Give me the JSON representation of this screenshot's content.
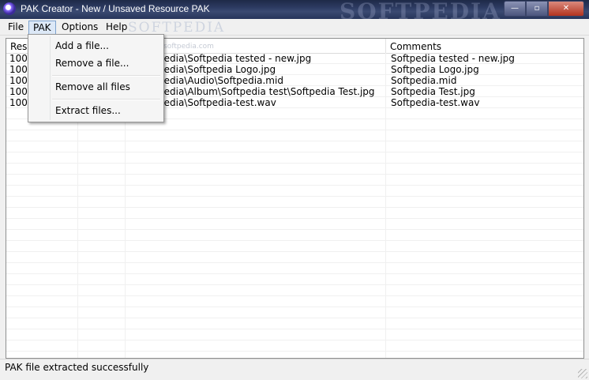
{
  "window": {
    "title": "PAK Creator - New / Unsaved Resource PAK",
    "watermark": "SOFTPEDIA",
    "minimize": "—",
    "maximize": "▫",
    "close": "✕"
  },
  "menubar": {
    "items": [
      "File",
      "PAK",
      "Options",
      "Help"
    ],
    "active": "PAK",
    "watermark": "SOFTPEDIA"
  },
  "pak_menu": {
    "items": [
      "Add a file...",
      "Remove a file...",
      "Remove all files",
      "Extract files..."
    ]
  },
  "listview": {
    "columns": [
      "Res",
      "",
      "",
      "Comments"
    ],
    "watermark_url": "www.softpedia.com",
    "rows": [
      {
        "res": "1000",
        "path": "pedia\\Softpedia tested - new.jpg",
        "comment": "Softpedia tested - new.jpg"
      },
      {
        "res": "1000",
        "path": "pedia\\Softpedia Logo.jpg",
        "comment": "Softpedia Logo.jpg"
      },
      {
        "res": "1000",
        "path": "pedia\\Audio\\Softpedia.mid",
        "comment": "Softpedia.mid"
      },
      {
        "res": "1000",
        "path": "pedia\\Album\\Softpedia test\\Softpedia Test.jpg",
        "comment": "Softpedia Test.jpg"
      },
      {
        "res": "1000",
        "path": "pedia\\Softpedia-test.wav",
        "comment": "Softpedia-test.wav"
      }
    ]
  },
  "status": {
    "text": "PAK file extracted successfully"
  },
  "colors": {
    "titlebar": "#2d3b62",
    "menu_highlight": "#dce8f7",
    "close_button": "#c44a36"
  }
}
